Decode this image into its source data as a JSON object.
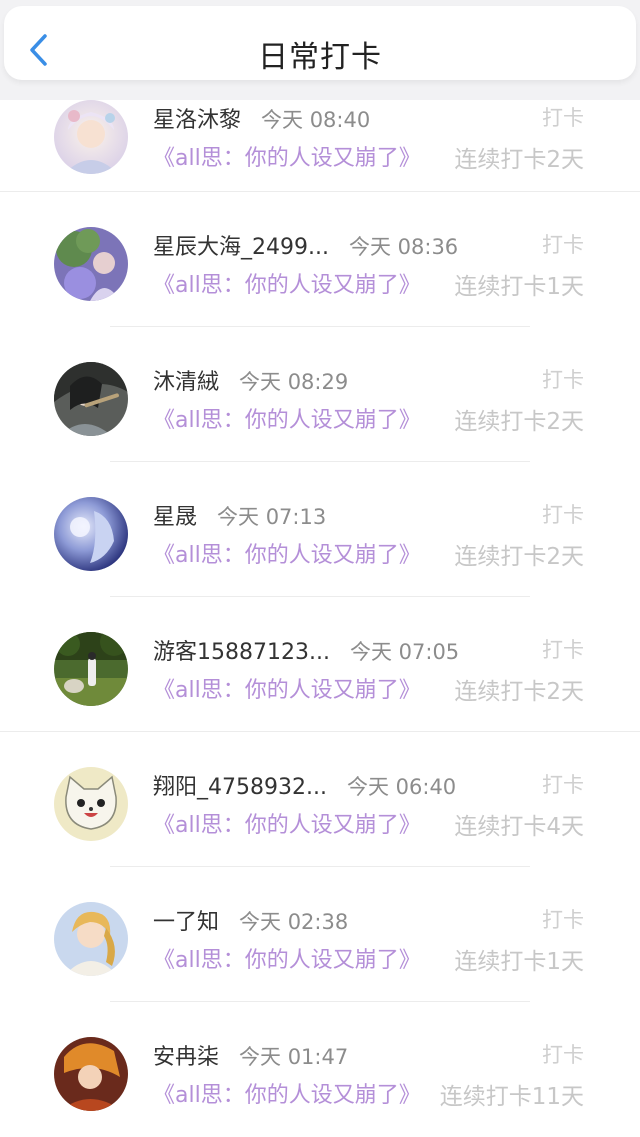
{
  "header": {
    "title": "日常打卡",
    "back_icon": "chevron-left-icon",
    "accent_color": "#3a8ee6"
  },
  "colors": {
    "book_title": "#b48fd8",
    "streak": "#c7c7c7",
    "checkin_label": "#cfcfcf",
    "time": "#8c8c8c"
  },
  "entries": [
    {
      "name": "星洛沐黎",
      "time": "今天 08:40",
      "label": "打卡",
      "book": "《all思：你的人设又崩了》",
      "streak": "连续打卡2天",
      "avatar_icon": "avatar-anime-girl-white"
    },
    {
      "name": "星辰大海_2499...",
      "time": "今天 08:36",
      "label": "打卡",
      "book": "《all思：你的人设又崩了》",
      "streak": "连续打卡1天",
      "avatar_icon": "avatar-photo-purple"
    },
    {
      "name": "沐清絨",
      "time": "今天 08:29",
      "label": "打卡",
      "book": "《all思：你的人设又崩了》",
      "streak": "连续打卡2天",
      "avatar_icon": "avatar-flute-player"
    },
    {
      "name": "星晟",
      "time": "今天 07:13",
      "label": "打卡",
      "book": "《all思：你的人设又崩了》",
      "streak": "连续打卡2天",
      "avatar_icon": "avatar-blue-wolf"
    },
    {
      "name": "游客15887123...",
      "time": "今天 07:05",
      "label": "打卡",
      "book": "《all思：你的人设又崩了》",
      "streak": "连续打卡2天",
      "avatar_icon": "avatar-outdoor-photo"
    },
    {
      "name": "翔阳_4758932...",
      "time": "今天 06:40",
      "label": "打卡",
      "book": "《all思：你的人设又崩了》",
      "streak": "连续打卡4天",
      "avatar_icon": "avatar-cat-mascot"
    },
    {
      "name": "一了知",
      "time": "今天 02:38",
      "label": "打卡",
      "book": "《all思：你的人设又崩了》",
      "streak": "连续打卡1天",
      "avatar_icon": "avatar-anime-boy-blonde"
    },
    {
      "name": "安冉柒",
      "time": "今天 01:47",
      "label": "打卡",
      "book": "《all思：你的人设又崩了》",
      "streak": "连续打卡11天",
      "avatar_icon": "avatar-anime-warrior"
    }
  ]
}
